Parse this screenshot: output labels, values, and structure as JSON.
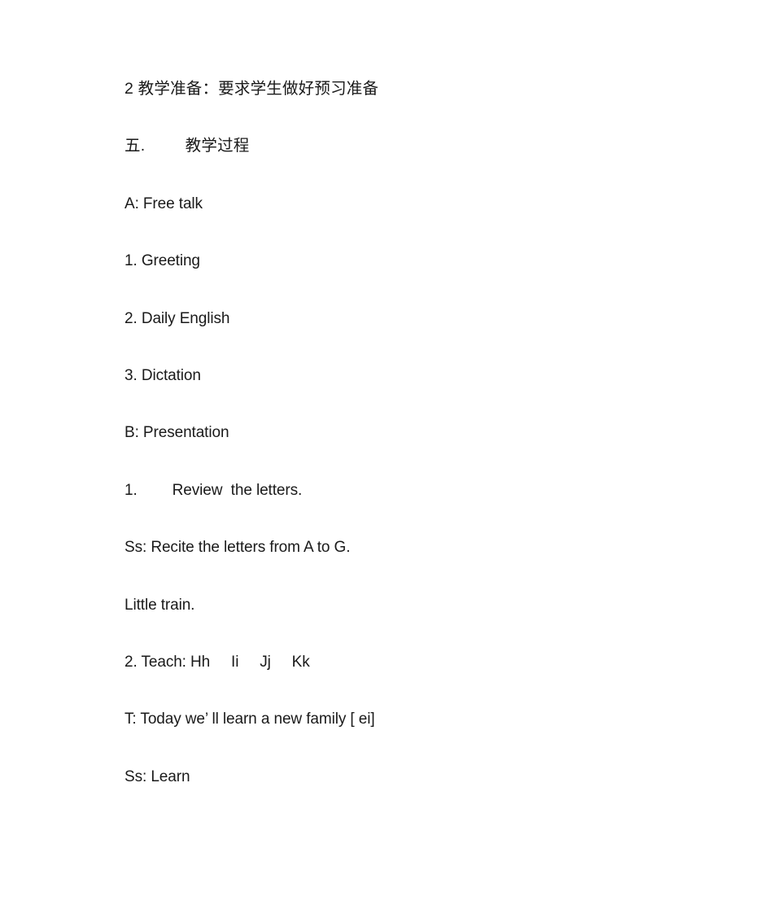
{
  "document": {
    "page_background": "#ffffff",
    "text_color": "#1a1a1a",
    "lines": [
      {
        "id": "teaching-preparation",
        "text": "2 教学准备：要求学生做好预习准备"
      },
      {
        "id": "section-five-process",
        "text": "五.   教学过程"
      },
      {
        "id": "part-a-free-talk",
        "text": "A: Free talk"
      },
      {
        "id": "item-1-greeting",
        "text": "1. Greeting"
      },
      {
        "id": "item-2-daily-english",
        "text": "2. Daily English"
      },
      {
        "id": "item-3-dictation",
        "text": "3. Dictation"
      },
      {
        "id": "part-b-presentation",
        "text": "B: Presentation"
      },
      {
        "id": "item-1-review-letters",
        "text": "1.   Review  the letters."
      },
      {
        "id": "ss-recite-letters",
        "text": "Ss: Recite the letters from A to G."
      },
      {
        "id": "little-train",
        "text": "Little train."
      },
      {
        "id": "item-2-teach-letters",
        "text": "2. Teach: Hh     Ii     Jj     Kk"
      },
      {
        "id": "t-today-new-family",
        "text": "T: Today we’ ll learn a new family [ ei]"
      },
      {
        "id": "ss-learn",
        "text": "Ss: Learn"
      }
    ]
  }
}
